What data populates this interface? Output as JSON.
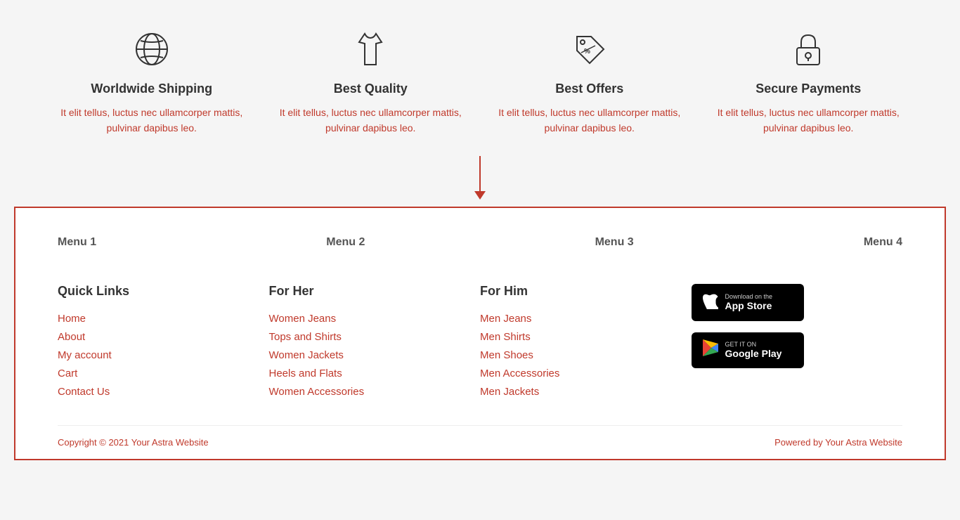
{
  "features": [
    {
      "id": "worldwide-shipping",
      "title": "Worldwide Shipping",
      "description": "It elit tellus, luctus nec ullamcorper mattis, pulvinar dapibus leo.",
      "icon": "globe"
    },
    {
      "id": "best-quality",
      "title": "Best Quality",
      "description": "It elit tellus, luctus nec ullamcorper mattis, pulvinar dapibus leo.",
      "icon": "dress"
    },
    {
      "id": "best-offers",
      "title": "Best Offers",
      "description": "It elit tellus, luctus nec ullamcorper mattis, pulvinar dapibus leo.",
      "icon": "tag"
    },
    {
      "id": "secure-payments",
      "title": "Secure Payments",
      "description": "It elit tellus, luctus nec ullamcorper mattis, pulvinar dapibus leo.",
      "icon": "lock"
    }
  ],
  "footer": {
    "menu_labels": [
      "Menu 1",
      "Menu 2",
      "Menu 3",
      "Menu 4"
    ],
    "quick_links": {
      "title": "Quick Links",
      "items": [
        "Home",
        "About",
        "My account",
        "Cart",
        "Contact Us"
      ]
    },
    "for_her": {
      "title": "For Her",
      "items": [
        "Women Jeans",
        "Tops and Shirts",
        "Women Jackets",
        "Heels and Flats",
        "Women Accessories"
      ]
    },
    "for_him": {
      "title": "For Him",
      "items": [
        "Men Jeans",
        "Men Shirts",
        "Men Shoes",
        "Men Accessories",
        "Men Jackets"
      ]
    },
    "app_store": {
      "small": "Download on the",
      "large": "App Store"
    },
    "google_play": {
      "small": "GET IT ON",
      "large": "Google Play"
    },
    "copyright": "Copyright © 2021 Your Astra Website",
    "powered": "Powered by Your Astra Website"
  }
}
